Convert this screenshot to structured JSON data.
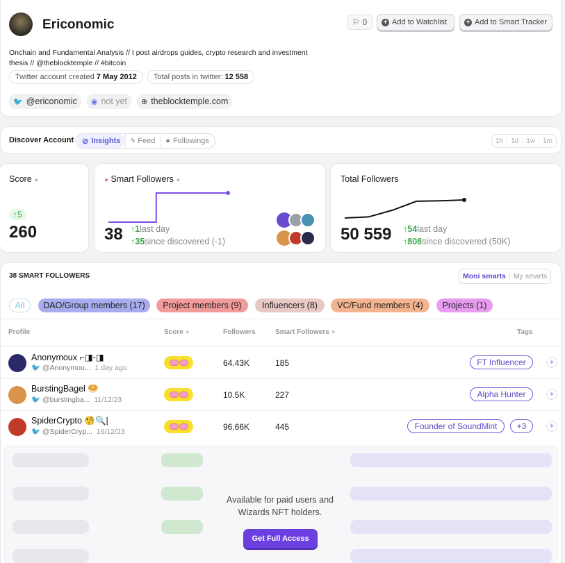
{
  "profile": {
    "name": "Ericonomic",
    "flag_count": "0",
    "watchlist_label": "Add to Watchlist",
    "tracker_label": "Add to Smart Tracker",
    "bio_line1": "Onchain and Fundamental Analysis // I post airdrops guides, crypto research and investment",
    "bio_line2": "thesis // @theblocktemple // #bitcoin",
    "created_label": "Twitter account created",
    "created_value": "7 May 2012",
    "posts_label": "Total posts in twitter:",
    "posts_value": "12 558",
    "twitter_handle": "@ericonomic",
    "discord_value": "not yet",
    "website": "theblocktemple.com"
  },
  "discover": {
    "label": "Discover Account",
    "tabs": [
      "Insights",
      "Feed",
      "Followings"
    ],
    "ranges": [
      "1h",
      "1d",
      "1w",
      "1m"
    ]
  },
  "stats": {
    "score_title": "Score",
    "score_delta": "↑5",
    "score_value": "260",
    "smart_title": "Smart Followers",
    "smart_value": "38",
    "smart_day_delta": "↑1",
    "smart_day_label": "last day",
    "smart_disc_delta": "↑35",
    "smart_disc_label": "since discovered (-1)",
    "total_title": "Total Followers",
    "total_value": "50 559",
    "total_day_delta": "↑54",
    "total_day_label": "last day",
    "total_disc_delta": "↑808",
    "total_disc_label": "since discovered (50K)"
  },
  "followers_section": {
    "title": "38 SMART FOLLOWERS",
    "toggle": [
      "Moni smarts",
      "My smarts"
    ],
    "filters": [
      {
        "label": "All",
        "color": "#ffffff"
      },
      {
        "label": "DAO/Group members (17)",
        "color": "#a9adf0"
      },
      {
        "label": "Project members (9)",
        "color": "#f39a9a"
      },
      {
        "label": "Influencers (8)",
        "color": "#e8c9c6"
      },
      {
        "label": "VC/Fund members (4)",
        "color": "#f3b48f"
      },
      {
        "label": "Projects (1)",
        "color": "#e79cf0"
      }
    ],
    "columns": {
      "profile": "Profile",
      "score": "Score",
      "followers": "Followers",
      "smart": "Smart Followers",
      "tags": "Tags"
    },
    "rows": [
      {
        "name": "Anonymoux ⌐◨-◨",
        "handle": "@Anonymou...",
        "date": "1 day ago",
        "followers": "64.43K",
        "smart": "185",
        "tags": [
          "FT Influencer"
        ]
      },
      {
        "name": "BurstingBagel 🥯",
        "handle": "@burstingba...",
        "date": "11/12/23",
        "followers": "10.5K",
        "smart": "227",
        "tags": [
          "Alpha Hunter"
        ]
      },
      {
        "name": "SpiderCrypto 🧐🔍|",
        "handle": "@SpiderCryp...",
        "date": "16/12/23",
        "followers": "96.66K",
        "smart": "445",
        "tags": [
          "Founder of SoundMint",
          "+3"
        ]
      }
    ],
    "paywall_line1": "Available for paid users and",
    "paywall_line2": "Wizards NFT holders.",
    "paywall_button": "Get Full Access"
  },
  "chart_data": [
    {
      "type": "line",
      "title": "Smart Followers",
      "x": [
        0,
        1,
        2,
        3,
        4,
        5
      ],
      "values": [
        36,
        36,
        38,
        38,
        38,
        38
      ]
    },
    {
      "type": "line",
      "title": "Total Followers",
      "x": [
        0,
        1,
        2,
        3,
        4,
        5
      ],
      "values": [
        49751,
        49800,
        50100,
        50500,
        50520,
        50559
      ]
    }
  ],
  "colors": {
    "accent": "#6b3fe0",
    "green": "#3aa64b",
    "line_smart": "#7b4fe6",
    "line_total": "#111111",
    "paywall_btn": "#6b3fe0"
  }
}
